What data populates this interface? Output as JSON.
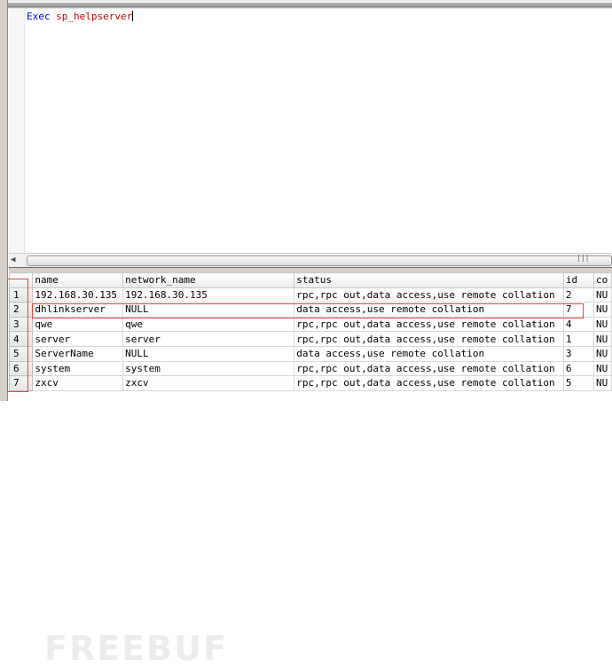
{
  "editor": {
    "keyword": "Exec",
    "procedure": "sp_helpserver"
  },
  "grid": {
    "columns": [
      "name",
      "network_name",
      "status",
      "id",
      "co"
    ],
    "rows": [
      {
        "n": "1",
        "name": "192.168.30.135",
        "network_name": "192.168.30.135",
        "status": "rpc,rpc out,data access,use remote collation",
        "id": "2",
        "co": "NU"
      },
      {
        "n": "2",
        "name": "dhlinkserver",
        "network_name": "NULL",
        "status": "data access,use remote collation",
        "id": "7",
        "co": "NU"
      },
      {
        "n": "3",
        "name": "qwe",
        "network_name": "qwe",
        "status": "rpc,rpc out,data access,use remote collation",
        "id": "4",
        "co": "NU"
      },
      {
        "n": "4",
        "name": "server",
        "network_name": "server",
        "status": "rpc,rpc out,data access,use remote collation",
        "id": "1",
        "co": "NU"
      },
      {
        "n": "5",
        "name": "ServerName",
        "network_name": "NULL",
        "status": "data access,use remote collation",
        "id": "3",
        "co": "NU"
      },
      {
        "n": "6",
        "name": "system",
        "network_name": "system",
        "status": "rpc,rpc out,data access,use remote collation",
        "id": "6",
        "co": "NU"
      },
      {
        "n": "7",
        "name": "zxcv",
        "network_name": "zxcv",
        "status": "rpc,rpc out,data access,use remote collation",
        "id": "5",
        "co": "NU"
      }
    ]
  },
  "watermark": "FREEBUF"
}
